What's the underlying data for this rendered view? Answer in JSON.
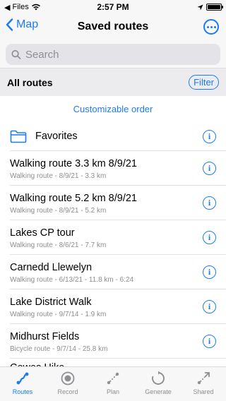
{
  "status_bar": {
    "carrier": "Files",
    "time": "2:57 PM"
  },
  "nav": {
    "back_label": "Map",
    "title": "Saved routes"
  },
  "search": {
    "placeholder": "Search",
    "value": ""
  },
  "section": {
    "title": "All routes",
    "filter_label": "Filter"
  },
  "customizable_order_label": "Customizable order",
  "favorites_label": "Favorites",
  "routes": [
    {
      "title": "Walking route 3.3 km 8/9/21",
      "subtitle": "Walking route - 8/9/21 - 3.3 km"
    },
    {
      "title": "Walking route 5.2 km 8/9/21",
      "subtitle": "Walking route - 8/9/21 - 5.2 km"
    },
    {
      "title": "Lakes CP tour",
      "subtitle": "Walking route - 8/6/21 - 7.7 km"
    },
    {
      "title": "Carnedd Llewelyn",
      "subtitle": "Walking route - 6/13/21 - 11.8 km - 6:24"
    },
    {
      "title": "Lake District Walk",
      "subtitle": "Walking route - 9/7/14 - 1.9 km"
    },
    {
      "title": "Midhurst Fields",
      "subtitle": "Bicycle route - 9/7/14 - 25.8 km"
    }
  ],
  "partial_route_title": "Cowes Hike",
  "tabs": [
    {
      "label": "Routes",
      "icon": "route-icon",
      "active": true
    },
    {
      "label": "Record",
      "icon": "record-icon",
      "active": false
    },
    {
      "label": "Plan",
      "icon": "plan-icon",
      "active": false
    },
    {
      "label": "Generate",
      "icon": "generate-icon",
      "active": false
    },
    {
      "label": "Shared",
      "icon": "shared-icon",
      "active": false
    }
  ],
  "colors": {
    "accent": "#1a7cf0",
    "secondary_text": "#8e8e93",
    "header_bg": "#ececef"
  }
}
